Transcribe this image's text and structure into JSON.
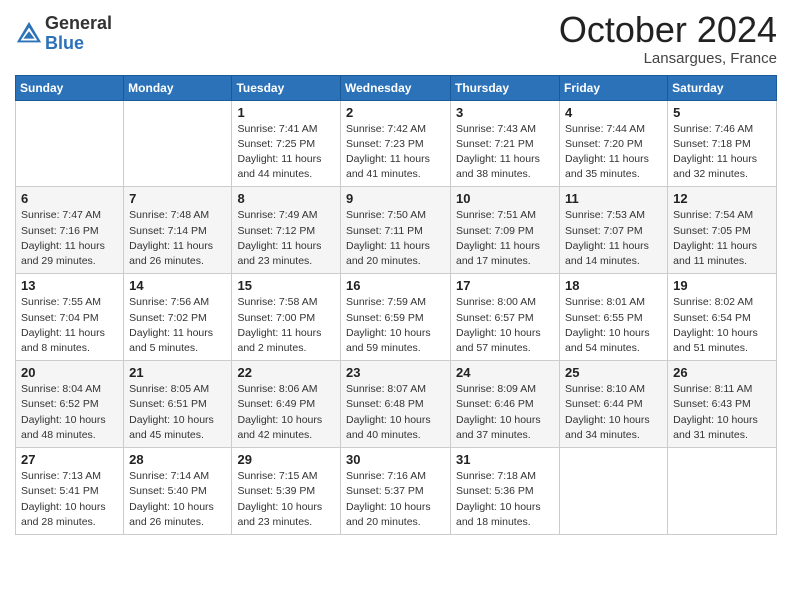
{
  "logo": {
    "general": "General",
    "blue": "Blue"
  },
  "header": {
    "month": "October 2024",
    "location": "Lansargues, France"
  },
  "weekdays": [
    "Sunday",
    "Monday",
    "Tuesday",
    "Wednesday",
    "Thursday",
    "Friday",
    "Saturday"
  ],
  "weeks": [
    [
      {
        "day": "",
        "info": ""
      },
      {
        "day": "",
        "info": ""
      },
      {
        "day": "1",
        "info": "Sunrise: 7:41 AM\nSunset: 7:25 PM\nDaylight: 11 hours and 44 minutes."
      },
      {
        "day": "2",
        "info": "Sunrise: 7:42 AM\nSunset: 7:23 PM\nDaylight: 11 hours and 41 minutes."
      },
      {
        "day": "3",
        "info": "Sunrise: 7:43 AM\nSunset: 7:21 PM\nDaylight: 11 hours and 38 minutes."
      },
      {
        "day": "4",
        "info": "Sunrise: 7:44 AM\nSunset: 7:20 PM\nDaylight: 11 hours and 35 minutes."
      },
      {
        "day": "5",
        "info": "Sunrise: 7:46 AM\nSunset: 7:18 PM\nDaylight: 11 hours and 32 minutes."
      }
    ],
    [
      {
        "day": "6",
        "info": "Sunrise: 7:47 AM\nSunset: 7:16 PM\nDaylight: 11 hours and 29 minutes."
      },
      {
        "day": "7",
        "info": "Sunrise: 7:48 AM\nSunset: 7:14 PM\nDaylight: 11 hours and 26 minutes."
      },
      {
        "day": "8",
        "info": "Sunrise: 7:49 AM\nSunset: 7:12 PM\nDaylight: 11 hours and 23 minutes."
      },
      {
        "day": "9",
        "info": "Sunrise: 7:50 AM\nSunset: 7:11 PM\nDaylight: 11 hours and 20 minutes."
      },
      {
        "day": "10",
        "info": "Sunrise: 7:51 AM\nSunset: 7:09 PM\nDaylight: 11 hours and 17 minutes."
      },
      {
        "day": "11",
        "info": "Sunrise: 7:53 AM\nSunset: 7:07 PM\nDaylight: 11 hours and 14 minutes."
      },
      {
        "day": "12",
        "info": "Sunrise: 7:54 AM\nSunset: 7:05 PM\nDaylight: 11 hours and 11 minutes."
      }
    ],
    [
      {
        "day": "13",
        "info": "Sunrise: 7:55 AM\nSunset: 7:04 PM\nDaylight: 11 hours and 8 minutes."
      },
      {
        "day": "14",
        "info": "Sunrise: 7:56 AM\nSunset: 7:02 PM\nDaylight: 11 hours and 5 minutes."
      },
      {
        "day": "15",
        "info": "Sunrise: 7:58 AM\nSunset: 7:00 PM\nDaylight: 11 hours and 2 minutes."
      },
      {
        "day": "16",
        "info": "Sunrise: 7:59 AM\nSunset: 6:59 PM\nDaylight: 10 hours and 59 minutes."
      },
      {
        "day": "17",
        "info": "Sunrise: 8:00 AM\nSunset: 6:57 PM\nDaylight: 10 hours and 57 minutes."
      },
      {
        "day": "18",
        "info": "Sunrise: 8:01 AM\nSunset: 6:55 PM\nDaylight: 10 hours and 54 minutes."
      },
      {
        "day": "19",
        "info": "Sunrise: 8:02 AM\nSunset: 6:54 PM\nDaylight: 10 hours and 51 minutes."
      }
    ],
    [
      {
        "day": "20",
        "info": "Sunrise: 8:04 AM\nSunset: 6:52 PM\nDaylight: 10 hours and 48 minutes."
      },
      {
        "day": "21",
        "info": "Sunrise: 8:05 AM\nSunset: 6:51 PM\nDaylight: 10 hours and 45 minutes."
      },
      {
        "day": "22",
        "info": "Sunrise: 8:06 AM\nSunset: 6:49 PM\nDaylight: 10 hours and 42 minutes."
      },
      {
        "day": "23",
        "info": "Sunrise: 8:07 AM\nSunset: 6:48 PM\nDaylight: 10 hours and 40 minutes."
      },
      {
        "day": "24",
        "info": "Sunrise: 8:09 AM\nSunset: 6:46 PM\nDaylight: 10 hours and 37 minutes."
      },
      {
        "day": "25",
        "info": "Sunrise: 8:10 AM\nSunset: 6:44 PM\nDaylight: 10 hours and 34 minutes."
      },
      {
        "day": "26",
        "info": "Sunrise: 8:11 AM\nSunset: 6:43 PM\nDaylight: 10 hours and 31 minutes."
      }
    ],
    [
      {
        "day": "27",
        "info": "Sunrise: 7:13 AM\nSunset: 5:41 PM\nDaylight: 10 hours and 28 minutes."
      },
      {
        "day": "28",
        "info": "Sunrise: 7:14 AM\nSunset: 5:40 PM\nDaylight: 10 hours and 26 minutes."
      },
      {
        "day": "29",
        "info": "Sunrise: 7:15 AM\nSunset: 5:39 PM\nDaylight: 10 hours and 23 minutes."
      },
      {
        "day": "30",
        "info": "Sunrise: 7:16 AM\nSunset: 5:37 PM\nDaylight: 10 hours and 20 minutes."
      },
      {
        "day": "31",
        "info": "Sunrise: 7:18 AM\nSunset: 5:36 PM\nDaylight: 10 hours and 18 minutes."
      },
      {
        "day": "",
        "info": ""
      },
      {
        "day": "",
        "info": ""
      }
    ]
  ]
}
